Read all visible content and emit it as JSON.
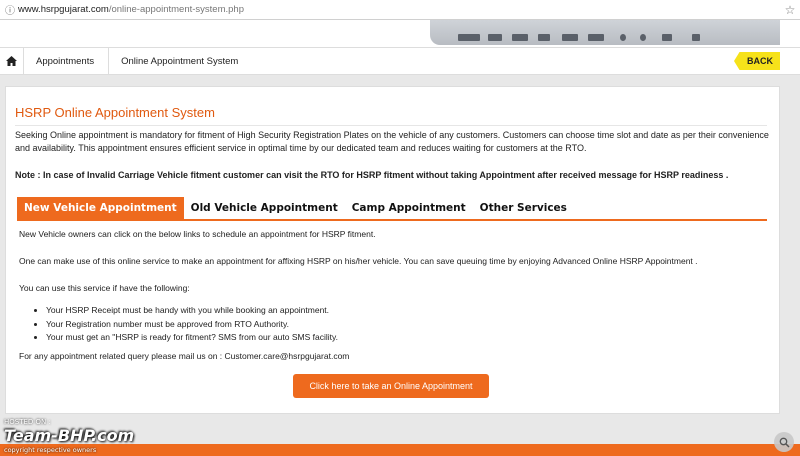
{
  "browser": {
    "url_host": "www.hsrpgujarat.com",
    "url_path": "/online-appointment-system.php",
    "info_icon": "info-icon",
    "star_icon": "star-icon"
  },
  "breadcrumb": {
    "home_icon": "home-icon",
    "items": [
      "Appointments",
      "Online Appointment System"
    ],
    "back_label": "BACK"
  },
  "page": {
    "title": "HSRP Online Appointment System",
    "intro": "Seeking Online appointment is mandatory for fitment of High Security Registration Plates on the vehicle of any customers. Customers can choose time slot and date as per their convenience and availability. This appointment ensures efficient service in optimal time by our dedicated team and reduces waiting for customers at the RTO.",
    "note": "Note : In case of Invalid Carriage Vehicle fitment customer can visit the RTO for HSRP fitment without taking Appointment after received message for HSRP readiness ."
  },
  "tabs": [
    {
      "label": "New Vehicle Appointment",
      "active": true
    },
    {
      "label": "Old Vehicle Appointment",
      "active": false
    },
    {
      "label": "Camp Appointment",
      "active": false
    },
    {
      "label": "Other Services",
      "active": false
    }
  ],
  "content": {
    "line1": "New Vehicle owners can click on the below links to schedule an appointment for HSRP fitment.",
    "line2": "One can make use of this online service to make an appointment for affixing HSRP on his/her vehicle. You can save queuing time by enjoying Advanced Online HSRP Appointment .",
    "line3": "You can use this service if have the following:",
    "bullets": [
      "Your HSRP Receipt must be handy with you while booking an appointment.",
      "Your Registration number must be approved from RTO Authority.",
      "Your must get an \"HSRP is ready for fitment? SMS from our auto SMS facility."
    ],
    "contact": "For any appointment related query please mail us on : Customer.care@hsrpgujarat.com",
    "cta_label": "Click here to take an Online Appointment"
  },
  "watermark": {
    "hosted_on": "HOSTED ON :",
    "brand": "Team-BHP.com",
    "copyright": "copyright respective owners"
  },
  "colors": {
    "accent": "#ee6a1e",
    "title": "#e05a10",
    "back": "#f6e21a"
  }
}
